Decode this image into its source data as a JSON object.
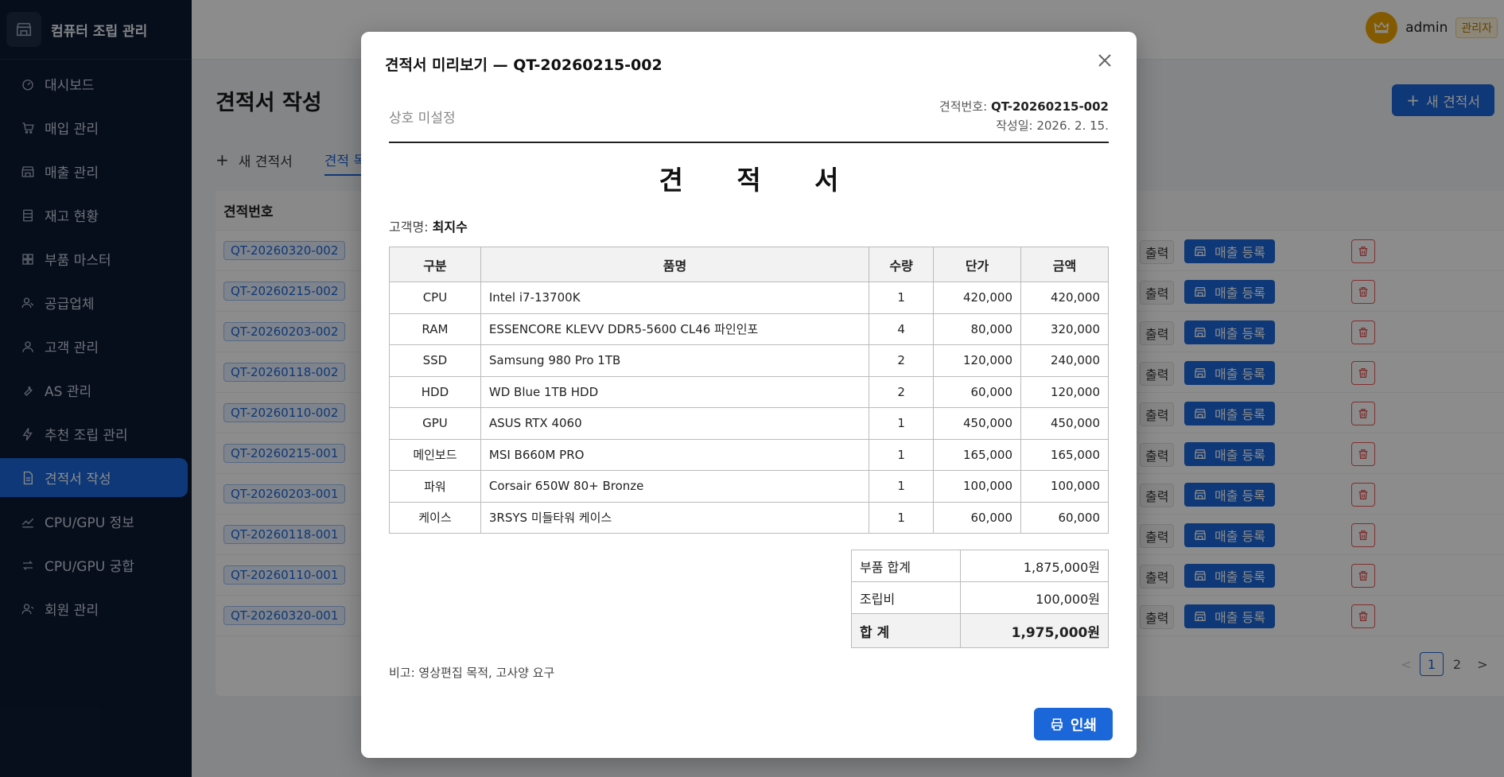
{
  "app": {
    "title": "컴퓨터 조립 관리"
  },
  "sidebar": {
    "items": [
      {
        "label": "대시보드",
        "icon": "dashboard-icon"
      },
      {
        "label": "매입 관리",
        "icon": "cart-icon"
      },
      {
        "label": "매출 관리",
        "icon": "store-icon"
      },
      {
        "label": "재고 현황",
        "icon": "inventory-icon"
      },
      {
        "label": "부품 마스터",
        "icon": "grid-icon"
      },
      {
        "label": "공급업체",
        "icon": "supplier-icon"
      },
      {
        "label": "고객 관리",
        "icon": "user-icon"
      },
      {
        "label": "AS 관리",
        "icon": "wrench-icon"
      },
      {
        "label": "추천 조립 관리",
        "icon": "bolt-icon"
      },
      {
        "label": "견적서 작성",
        "icon": "document-icon"
      },
      {
        "label": "CPU/GPU 정보",
        "icon": "chart-icon"
      },
      {
        "label": "CPU/GPU 궁합",
        "icon": "swap-icon"
      },
      {
        "label": "회원 관리",
        "icon": "members-icon"
      }
    ],
    "active_index": 9
  },
  "header": {
    "user": "admin",
    "role": "관리자"
  },
  "page": {
    "title": "견적서 작성",
    "new_button": "새 견적서",
    "tabs": [
      {
        "label": "새 견적서"
      },
      {
        "label": "견적 목"
      }
    ],
    "list_header": "견적번호",
    "rows": [
      "QT-20260320-002",
      "QT-20260215-002",
      "QT-20260203-002",
      "QT-20260118-002",
      "QT-20260110-002",
      "QT-20260215-001",
      "QT-20260203-001",
      "QT-20260118-001",
      "QT-20260110-001",
      "QT-20260320-001"
    ],
    "print_label": "출력",
    "sale_label": "매출 등록",
    "pager": {
      "pages": [
        "1",
        "2"
      ],
      "current": "1",
      "prev": "<",
      "next": ">"
    }
  },
  "modal": {
    "title": "견적서 미리보기 — QT-20260215-002",
    "company": "상호 미설정",
    "quote_no_label": "견적번호: ",
    "quote_no": "QT-20260215-002",
    "date_label": "작성일: 2026. 2. 15.",
    "doc_title": "견 적 서",
    "customer_label": "고객명: ",
    "customer_name": "최지수",
    "columns": [
      "구분",
      "품명",
      "수량",
      "단가",
      "금액"
    ],
    "items": [
      {
        "category": "CPU",
        "name": "Intel i7-13700K",
        "qty": "1",
        "price": "420,000",
        "amount": "420,000"
      },
      {
        "category": "RAM",
        "name": "ESSENCORE KLEVV DDR5-5600 CL46 파인인포",
        "qty": "4",
        "price": "80,000",
        "amount": "320,000"
      },
      {
        "category": "SSD",
        "name": "Samsung 980 Pro 1TB",
        "qty": "2",
        "price": "120,000",
        "amount": "240,000"
      },
      {
        "category": "HDD",
        "name": "WD Blue 1TB HDD",
        "qty": "2",
        "price": "60,000",
        "amount": "120,000"
      },
      {
        "category": "GPU",
        "name": "ASUS RTX 4060",
        "qty": "1",
        "price": "450,000",
        "amount": "450,000"
      },
      {
        "category": "메인보드",
        "name": "MSI B660M PRO",
        "qty": "1",
        "price": "165,000",
        "amount": "165,000"
      },
      {
        "category": "파워",
        "name": "Corsair 650W 80+ Bronze",
        "qty": "1",
        "price": "100,000",
        "amount": "100,000"
      },
      {
        "category": "케이스",
        "name": "3RSYS 미들타워 케이스",
        "qty": "1",
        "price": "60,000",
        "amount": "60,000"
      }
    ],
    "totals": {
      "parts_label": "부품 합계",
      "parts_value": "1,875,000원",
      "assembly_label": "조립비",
      "assembly_value": "100,000원",
      "grand_label": "합 계",
      "grand_value": "1,975,000원"
    },
    "note": "비고: 영상편집 목적, 고사양 요구",
    "print_button": "인쇄"
  },
  "colors": {
    "accent": "#1b66d9",
    "sidebar_bg": "#0c1a33",
    "danger": "#e55555"
  }
}
